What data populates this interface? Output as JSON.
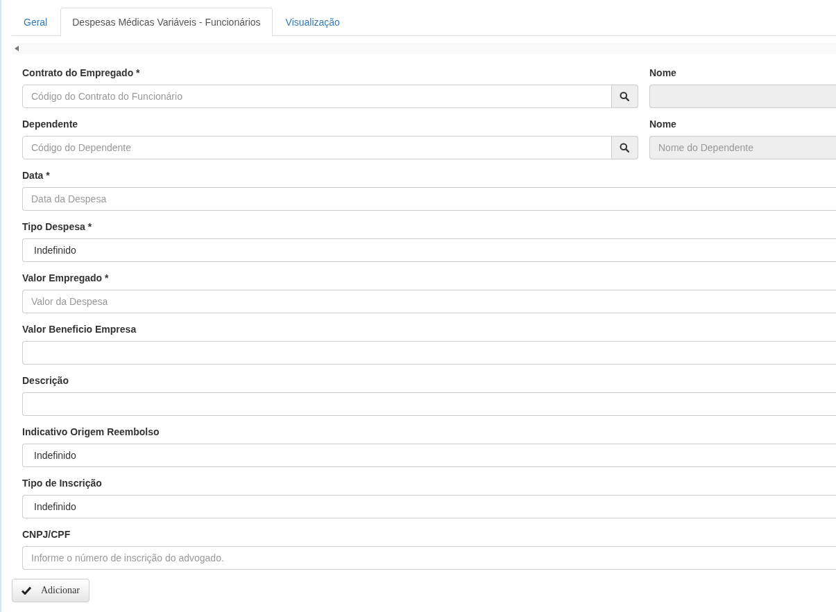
{
  "tabs": [
    {
      "label": "Geral",
      "selected": false
    },
    {
      "label": "Despesas Médicas Variáveis - Funcionários",
      "selected": true
    },
    {
      "label": "Visualização",
      "selected": false
    }
  ],
  "fields": [
    {
      "kind": "lookup",
      "label": "Contrato do Empregado *",
      "placeholder": "Código do Contrato do Funcionário",
      "name_label": "Nome"
    },
    {
      "kind": "lookup",
      "label": "Dependente",
      "placeholder": "Código do Dependente",
      "name_label": "Nome",
      "name_placeholder": "Nome do Dependente"
    },
    {
      "kind": "text",
      "label": "Data *",
      "placeholder": "Data da Despesa"
    },
    {
      "kind": "select",
      "label": "Tipo Despesa *",
      "value": "Indefinido"
    },
    {
      "kind": "text",
      "label": "Valor Empregado *",
      "placeholder": "Valor da Despesa"
    },
    {
      "kind": "text",
      "label": "Valor Beneficio Empresa"
    },
    {
      "kind": "text",
      "label": "Descrição"
    },
    {
      "kind": "select",
      "label": "Indicativo Origem Reembolso",
      "value": "Indefinido"
    },
    {
      "kind": "select",
      "label": "Tipo de Inscrição",
      "value": "Indefinido"
    },
    {
      "kind": "text",
      "label": "CNPJ/CPF",
      "placeholder": "Informe o número de inscrição do advogado."
    }
  ],
  "add_button": "Adicionar"
}
